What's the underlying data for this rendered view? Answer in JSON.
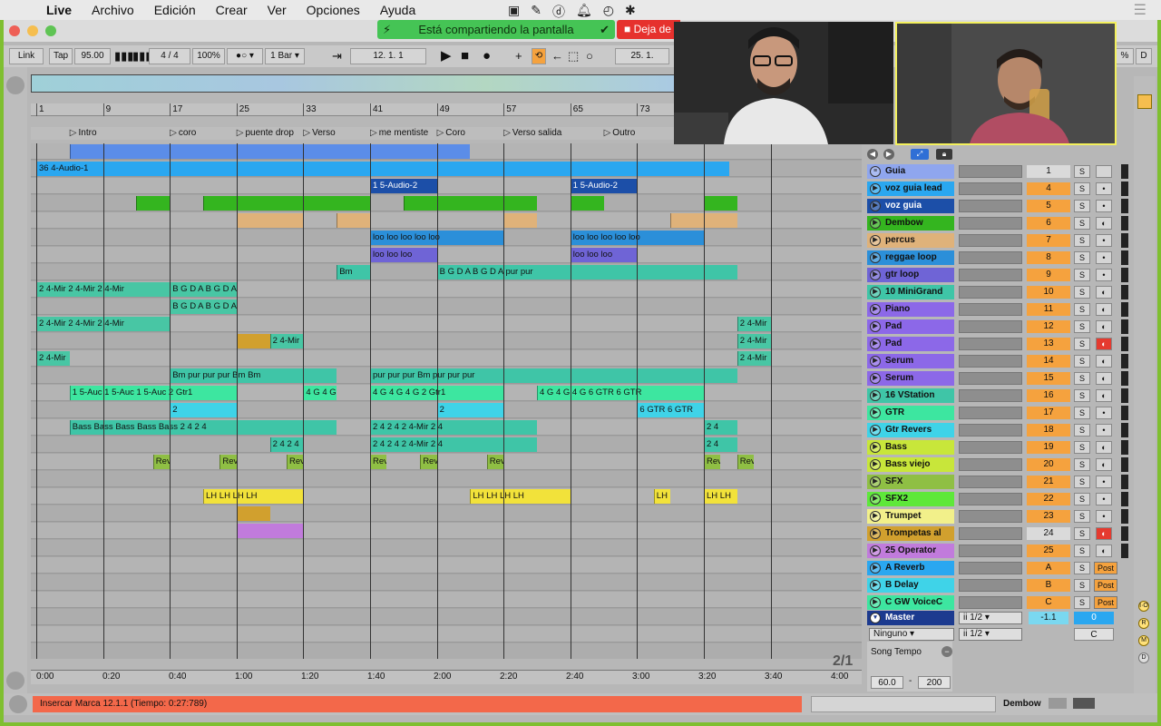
{
  "menubar": {
    "apple_icon": "apple-icon",
    "items": [
      "Live",
      "Archivo",
      "Edición",
      "Crear",
      "Ver",
      "Opciones",
      "Ayuda"
    ]
  },
  "screenshare": {
    "sharing_label": "Está compartiendo la pantalla",
    "stop_label": "Deja de"
  },
  "transport": {
    "link_label": "Link",
    "tap_label": "Tap",
    "tempo": "95.00",
    "signature": "4 / 4",
    "zoom": "100%",
    "metro_mode": "1 Bar",
    "arrangement_position": "12.  1.  1",
    "loop_start": "25.  1."
  },
  "arrangement": {
    "bar_numbers": [
      "1",
      "9",
      "17",
      "25",
      "33",
      "41",
      "49",
      "57",
      "65",
      "73"
    ],
    "locators": [
      "Intro",
      "coro",
      "puente drop",
      "Verso",
      "me mentiste",
      "Coro",
      "Verso salida",
      "Outro"
    ],
    "time_marks": [
      "0:00",
      "0:20",
      "0:40",
      "1:00",
      "1:20",
      "1:40",
      "2:00",
      "2:20",
      "2:40",
      "3:00",
      "3:20",
      "3:40",
      "4:00"
    ],
    "page_indicator": "2/1"
  },
  "lanes": [
    {
      "clips": [
        {
          "b": 4,
          "e": 52,
          "c": "#5b8de8",
          "t": ""
        }
      ]
    },
    {
      "clips": [
        {
          "b": 0,
          "e": 83,
          "c": "#2aa7f0",
          "t": "36 4-Audio-1"
        }
      ]
    },
    {
      "clips": [
        {
          "b": 40,
          "e": 48,
          "c": "#1c4fa8",
          "t": "1 5-Audio-2"
        },
        {
          "b": 64,
          "e": 72,
          "c": "#1c4fa8",
          "t": "1 5-Audio-2"
        }
      ]
    },
    {
      "clips": [
        {
          "b": 12,
          "e": 16,
          "c": "#34b51f",
          "t": ""
        },
        {
          "b": 20,
          "e": 40,
          "c": "#34b51f",
          "t": ""
        },
        {
          "b": 44,
          "e": 60,
          "c": "#34b51f",
          "t": ""
        },
        {
          "b": 64,
          "e": 68,
          "c": "#34b51f",
          "t": ""
        },
        {
          "b": 80,
          "e": 84,
          "c": "#34b51f",
          "t": ""
        }
      ]
    },
    {
      "clips": [
        {
          "b": 24,
          "e": 32,
          "c": "#dfb27a",
          "t": ""
        },
        {
          "b": 36,
          "e": 40,
          "c": "#dfb27a",
          "t": ""
        },
        {
          "b": 56,
          "e": 60,
          "c": "#dfb27a",
          "t": ""
        },
        {
          "b": 76,
          "e": 84,
          "c": "#dfb27a",
          "t": ""
        }
      ]
    },
    {
      "clips": [
        {
          "b": 40,
          "e": 56,
          "c": "#2b8fd9",
          "t": "loo loo loo loo loo"
        },
        {
          "b": 64,
          "e": 80,
          "c": "#2b8fd9",
          "t": "loo loo loo loo loo"
        }
      ]
    },
    {
      "clips": [
        {
          "b": 40,
          "e": 48,
          "c": "#6f64d6",
          "t": "loo loo loo"
        },
        {
          "b": 64,
          "e": 72,
          "c": "#6f64d6",
          "t": "loo loo loo"
        }
      ]
    },
    {
      "clips": [
        {
          "b": 36,
          "e": 40,
          "c": "#3fc5a7",
          "t": "Bm"
        },
        {
          "b": 48,
          "e": 84,
          "c": "#3fc5a7",
          "t": "B G D A B G D A pur pur"
        }
      ]
    },
    {
      "clips": [
        {
          "b": 0,
          "e": 16,
          "c": "#48c6a4",
          "t": "2 4-Mir 2 4-Mir 2 4-Mir"
        },
        {
          "b": 16,
          "e": 24,
          "c": "#48c6a4",
          "t": "B G D A B G D A"
        }
      ]
    },
    {
      "clips": [
        {
          "b": 16,
          "e": 24,
          "c": "#48c6a4",
          "t": "B G D A B G D A"
        }
      ]
    },
    {
      "clips": [
        {
          "b": 0,
          "e": 16,
          "c": "#48c6a4",
          "t": "2 4-Mir 2 4-Mir 2 4-Mir"
        },
        {
          "b": 84,
          "e": 88,
          "c": "#48c6a4",
          "t": "2 4-Mir"
        }
      ]
    },
    {
      "clips": [
        {
          "b": 24,
          "e": 28,
          "c": "#d1a02e",
          "t": ""
        },
        {
          "b": 28,
          "e": 32,
          "c": "#48c6a4",
          "t": "2 4-Mir"
        },
        {
          "b": 84,
          "e": 88,
          "c": "#48c6a4",
          "t": "2 4-Mir"
        }
      ]
    },
    {
      "clips": [
        {
          "b": 0,
          "e": 4,
          "c": "#48c6a4",
          "t": "2 4-Mir"
        },
        {
          "b": 84,
          "e": 88,
          "c": "#48c6a4",
          "t": "2 4-Mir"
        }
      ]
    },
    {
      "clips": [
        {
          "b": 16,
          "e": 36,
          "c": "#3fc5a7",
          "t": "Bm pur pur pur Bm Bm"
        },
        {
          "b": 40,
          "e": 84,
          "c": "#3fc5a7",
          "t": "pur pur pur Bm pur pur pur"
        }
      ]
    },
    {
      "clips": [
        {
          "b": 4,
          "e": 24,
          "c": "#3de6a0",
          "t": "1 5-Auc 1 5-Auc 1 5-Auc 2 Gtr1"
        },
        {
          "b": 32,
          "e": 36,
          "c": "#3de6a0",
          "t": "4 G 4 G"
        },
        {
          "b": 40,
          "e": 56,
          "c": "#3de6a0",
          "t": "4 G 4 G 4 G 2 Gtr1"
        },
        {
          "b": 60,
          "e": 80,
          "c": "#3de6a0",
          "t": "4 G 4 G 4 G 6 GTR 6 GTR"
        }
      ]
    },
    {
      "clips": [
        {
          "b": 16,
          "e": 24,
          "c": "#3fd3e8",
          "t": "2"
        },
        {
          "b": 48,
          "e": 56,
          "c": "#3fd3e8",
          "t": "2"
        },
        {
          "b": 72,
          "e": 80,
          "c": "#3fd3e8",
          "t": "6 GTR 6 GTR"
        }
      ]
    },
    {
      "clips": [
        {
          "b": 4,
          "e": 36,
          "c": "#3fc5a7",
          "t": "Bass Bass Bass Bass Bass 2 4 2 4"
        },
        {
          "b": 40,
          "e": 60,
          "c": "#3fc5a7",
          "t": "2 4 2 4 2 4-Mir 2 4"
        },
        {
          "b": 80,
          "e": 84,
          "c": "#3fc5a7",
          "t": "2 4"
        }
      ]
    },
    {
      "clips": [
        {
          "b": 28,
          "e": 32,
          "c": "#3fc5a7",
          "t": "2 4 2 4"
        },
        {
          "b": 40,
          "e": 60,
          "c": "#3fc5a7",
          "t": "2 4 2 4 2 4-Mir 2 4"
        },
        {
          "b": 80,
          "e": 84,
          "c": "#3fc5a7",
          "t": "2 4"
        }
      ]
    },
    {
      "clips": [
        {
          "b": 14,
          "e": 16,
          "c": "#8fbf44",
          "t": "Rev"
        },
        {
          "b": 22,
          "e": 24,
          "c": "#8fbf44",
          "t": "Rev"
        },
        {
          "b": 30,
          "e": 32,
          "c": "#8fbf44",
          "t": "Rev"
        },
        {
          "b": 40,
          "e": 42,
          "c": "#8fbf44",
          "t": "Rev"
        },
        {
          "b": 46,
          "e": 48,
          "c": "#8fbf44",
          "t": "Rev"
        },
        {
          "b": 54,
          "e": 56,
          "c": "#8fbf44",
          "t": "Rev"
        },
        {
          "b": 80,
          "e": 82,
          "c": "#8fbf44",
          "t": "Rev"
        },
        {
          "b": 84,
          "e": 86,
          "c": "#8fbf44",
          "t": "Rev"
        }
      ]
    },
    {
      "clips": []
    },
    {
      "clips": [
        {
          "b": 20,
          "e": 32,
          "c": "#f2e23a",
          "t": "LH LH LH LH"
        },
        {
          "b": 52,
          "e": 64,
          "c": "#f2e23a",
          "t": "LH LH LH LH"
        },
        {
          "b": 74,
          "e": 76,
          "c": "#f2e23a",
          "t": "LH"
        },
        {
          "b": 80,
          "e": 84,
          "c": "#f2e23a",
          "t": "LH LH"
        }
      ]
    },
    {
      "clips": [
        {
          "b": 24,
          "e": 28,
          "c": "#d1a02e",
          "t": ""
        }
      ]
    },
    {
      "clips": [
        {
          "b": 24,
          "e": 32,
          "c": "#c17bdc",
          "t": ""
        }
      ]
    },
    {
      "clips": []
    },
    {
      "clips": []
    },
    {
      "clips": []
    },
    {
      "clips": []
    },
    {
      "clips": []
    },
    {
      "clips": []
    },
    {
      "clips": []
    },
    {
      "clips": []
    }
  ],
  "tracks": [
    {
      "name": "Guia",
      "color": "#8fa6ee",
      "num": "1",
      "numOff": true,
      "arm": ""
    },
    {
      "name": "voz guia lead",
      "color": "#2aa7f0",
      "num": "4",
      "numOff": false,
      "arm": "•"
    },
    {
      "name": "voz guia",
      "color": "#1c4fa8",
      "num": "5",
      "numOff": false,
      "arm": "•",
      "light": true
    },
    {
      "name": "Dembow",
      "color": "#34b51f",
      "num": "6",
      "numOff": false,
      "arm": "◐"
    },
    {
      "name": "percus",
      "color": "#dfb27a",
      "num": "7",
      "numOff": false,
      "arm": "•"
    },
    {
      "name": "reggae loop",
      "color": "#2b8fd9",
      "num": "8",
      "numOff": false,
      "arm": "•"
    },
    {
      "name": "gtr loop",
      "color": "#6f64d6",
      "num": "9",
      "numOff": false,
      "arm": "•"
    },
    {
      "name": "10 MiniGrand",
      "color": "#3fc5a7",
      "num": "10",
      "numOff": false,
      "arm": "◐"
    },
    {
      "name": "Piano",
      "color": "#8c68e8",
      "num": "11",
      "numOff": false,
      "arm": "◐"
    },
    {
      "name": "Pad",
      "color": "#8c68e8",
      "num": "12",
      "numOff": false,
      "arm": "◐"
    },
    {
      "name": "Pad",
      "color": "#8c68e8",
      "num": "13",
      "numOff": false,
      "arm": "◐",
      "armOn": true
    },
    {
      "name": "Serum",
      "color": "#8c68e8",
      "num": "14",
      "numOff": false,
      "arm": "◐"
    },
    {
      "name": "Serum",
      "color": "#8c68e8",
      "num": "15",
      "numOff": false,
      "arm": "◐"
    },
    {
      "name": "16 VStation",
      "color": "#3fc5a7",
      "num": "16",
      "numOff": false,
      "arm": "◐"
    },
    {
      "name": "GTR",
      "color": "#3de6a0",
      "num": "17",
      "numOff": false,
      "arm": "•"
    },
    {
      "name": "Gtr Revers",
      "color": "#3fd3e8",
      "num": "18",
      "numOff": false,
      "arm": "•"
    },
    {
      "name": "Bass",
      "color": "#c8e63a",
      "num": "19",
      "numOff": false,
      "arm": "◐"
    },
    {
      "name": "Bass viejo",
      "color": "#c8e63a",
      "num": "20",
      "numOff": false,
      "arm": "◐"
    },
    {
      "name": "SFX",
      "color": "#8fbf44",
      "num": "21",
      "numOff": false,
      "arm": "•"
    },
    {
      "name": "SFX2",
      "color": "#5ee83a",
      "num": "22",
      "numOff": false,
      "arm": "•"
    },
    {
      "name": "Trumpet",
      "color": "#f2f08a",
      "num": "23",
      "numOff": false,
      "arm": "•"
    },
    {
      "name": "Trompetas al",
      "color": "#d1a02e",
      "num": "24",
      "numOff": true,
      "arm": "◐",
      "armOn": true
    },
    {
      "name": "25 Operator",
      "color": "#c17bdc",
      "num": "25",
      "numOff": false,
      "arm": "◐"
    }
  ],
  "returns": [
    {
      "name": "A Reverb",
      "color": "#2aa7f0",
      "letter": "A",
      "post": "Post"
    },
    {
      "name": "B Delay",
      "color": "#3fd3e8",
      "letter": "B",
      "post": "Post"
    },
    {
      "name": "C GW VoiceC",
      "color": "#3de6a0",
      "letter": "C",
      "post": "Post"
    }
  ],
  "master": {
    "name": "Master",
    "color": "#1c3a8f",
    "routing_1": "ii 1/2",
    "routing_2": "ii 1/2",
    "volume": "-1.1",
    "pan": "0",
    "cue": "C",
    "input": "Ninguno"
  },
  "tempo_section": {
    "label": "Song Tempo",
    "min": "60.0",
    "dash": "-",
    "max": "200"
  },
  "status": {
    "info_message": "Insercar Marca 12.1.1 (Tiempo: 0:27:789)",
    "device_name": "Dembow"
  },
  "right_panel_buttons": [
    "I·O",
    "R",
    "M",
    "D"
  ],
  "colors": {
    "accent_orange": "#f5a23e",
    "share_green": "#45c455",
    "stop_red": "#e6312d",
    "desktop_green": "#7fbf30"
  }
}
